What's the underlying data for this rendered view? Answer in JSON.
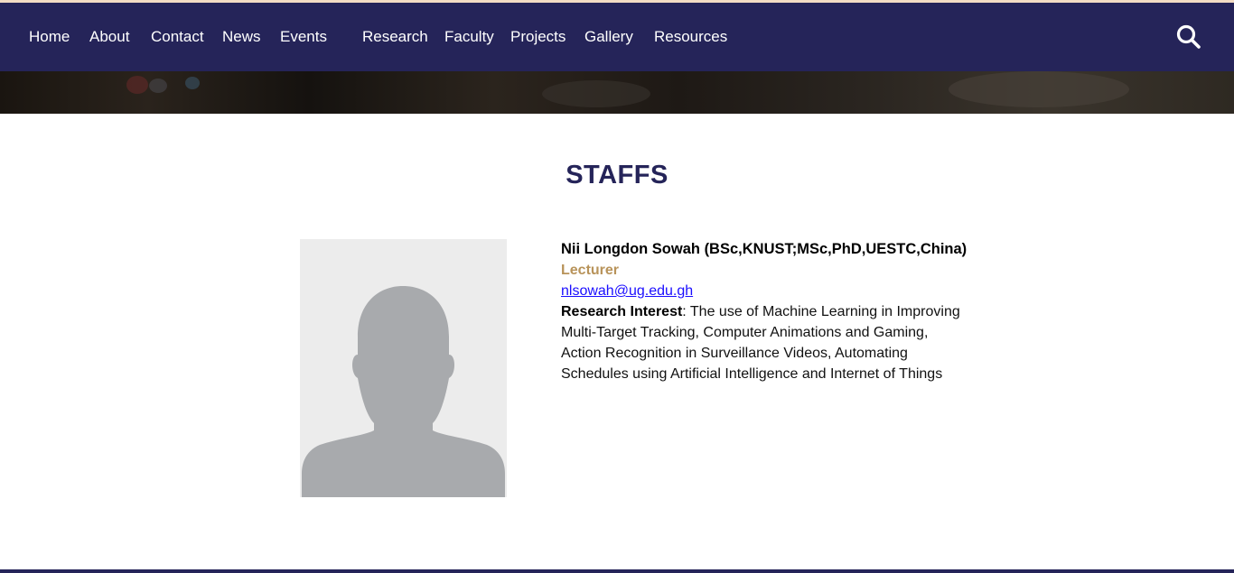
{
  "nav": {
    "items": [
      {
        "label": "Home"
      },
      {
        "label": "About"
      },
      {
        "label": "Contact"
      },
      {
        "label": "News"
      },
      {
        "label": "Events"
      },
      {
        "label": "Research"
      },
      {
        "label": "Faculty"
      },
      {
        "label": "Projects"
      },
      {
        "label": "Gallery"
      },
      {
        "label": "Resources"
      }
    ],
    "search_icon": "search-icon"
  },
  "page": {
    "title": "STAFFS"
  },
  "staff": {
    "photo_icon": "avatar-placeholder",
    "name": "Nii Longdon Sowah (BSc,KNUST;MSc,PhD,UESTC,China)",
    "role": "Lecturer",
    "email": "nlsowah@ug.edu.gh",
    "research_label": "Research Interest",
    "research_text": ": The use of Machine Learning in Improving Multi-Target Tracking, Computer Animations and Gaming, Action Recognition in Surveillance Videos, Automating Schedules using Artificial Intelligence and Internet of Things"
  },
  "colors": {
    "nav_bg": "#252459",
    "title": "#252459",
    "role": "#b8935a",
    "link": "#1a0dff"
  }
}
